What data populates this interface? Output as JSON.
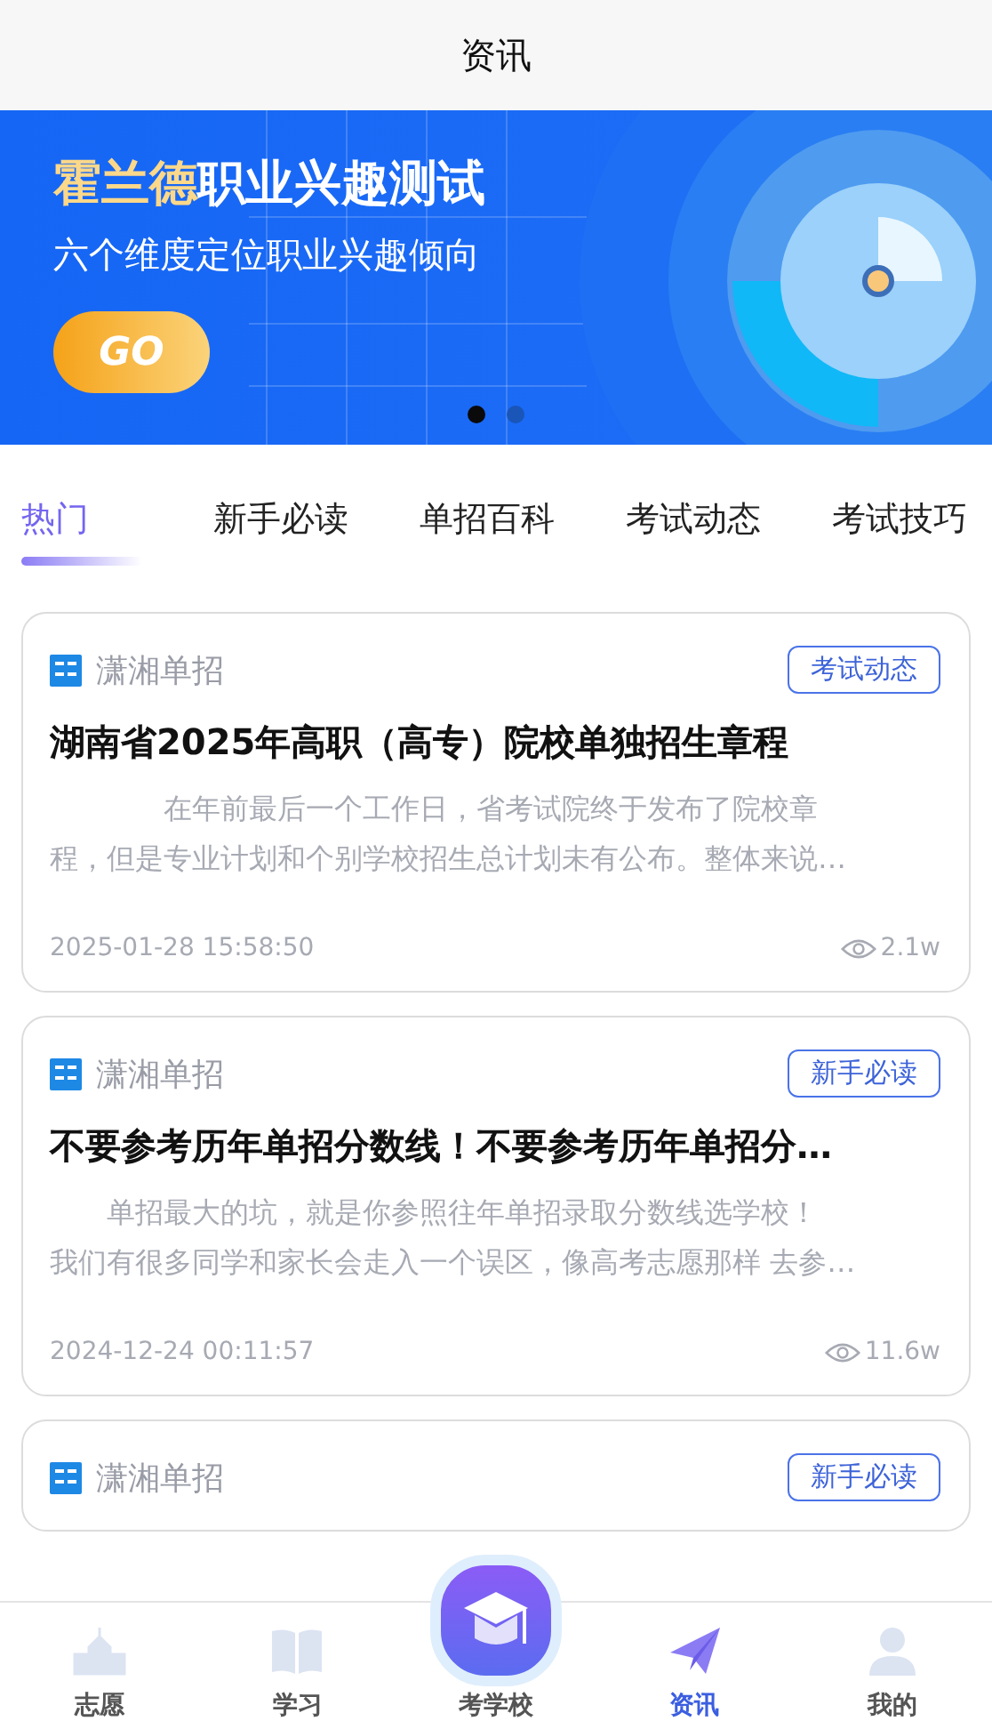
{
  "header": {
    "title": "资讯"
  },
  "banner": {
    "title_highlight": "霍兰德",
    "title": "职业兴趣测试",
    "subtitle": "六个维度定位职业兴趣倾向",
    "button": "GO",
    "dots": [
      {
        "selected": true
      },
      {
        "selected": false
      }
    ]
  },
  "tabs": [
    {
      "label": "热门",
      "selected": true
    },
    {
      "label": "新手必读",
      "selected": false
    },
    {
      "label": "单招百科",
      "selected": false
    },
    {
      "label": "考试动态",
      "selected": false
    },
    {
      "label": "考试技巧",
      "selected": false
    }
  ],
  "articles": [
    {
      "source": "潇湘单招",
      "tag": "考试动态",
      "title": "湖南省2025年高职（高专）院校单独招生章程",
      "summary_lines": [
        "　　　　在年前最后一个工作日，省考试院终于发布了院校章",
        "程，但是专业计划和个别学校招生总计划未有公布。整体来说…"
      ],
      "date": "2025-01-28 15:58:50",
      "views": "2.1w"
    },
    {
      "source": "潇湘单招",
      "tag": "新手必读",
      "title": "不要参考历年单招分数线！不要参考历年单招分…",
      "summary_lines": [
        "　　单招最大的坑，就是你参照往年单招录取分数线选学校！",
        "我们有很多同学和家长会走入一个误区，像高考志愿那样 去参…"
      ],
      "date": "2024-12-24 00:11:57",
      "views": "11.6w"
    },
    {
      "source": "潇湘单招",
      "tag": "新手必读"
    }
  ],
  "nav": [
    {
      "kind": "school",
      "label": "志愿",
      "selected": false
    },
    {
      "kind": "book",
      "label": "学习",
      "selected": false
    },
    {
      "kind": "center",
      "label": "考学校",
      "selected": false
    },
    {
      "kind": "plane",
      "label": "资讯",
      "selected": true
    },
    {
      "kind": "person",
      "label": "我的",
      "selected": false
    }
  ]
}
